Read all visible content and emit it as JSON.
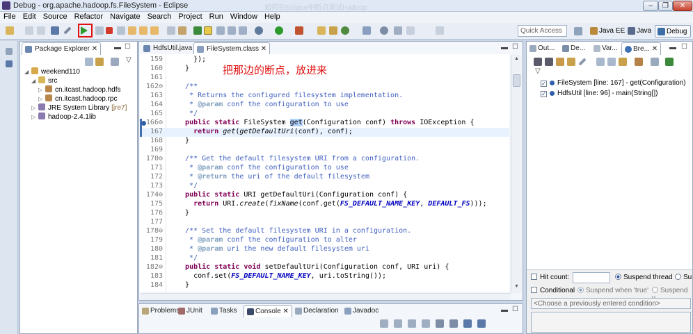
{
  "window": {
    "title": "Debug - org.apache.hadoop.fs.FileSystem - Eclipse",
    "blurred_title": "如何在Eclipse中断点调试Hadoop"
  },
  "menu": [
    "File",
    "Edit",
    "Source",
    "Refactor",
    "Navigate",
    "Search",
    "Project",
    "Run",
    "Window",
    "Help"
  ],
  "toolbar": {
    "quick_access_placeholder": "Quick Access"
  },
  "perspectives": [
    {
      "label": "Java EE"
    },
    {
      "label": "Java"
    },
    {
      "label": "Debug"
    }
  ],
  "package_explorer": {
    "tab": "Package Explorer",
    "tree": [
      {
        "label": "weekend110",
        "depth": 0,
        "expanded": true
      },
      {
        "label": "src",
        "depth": 1,
        "expanded": true
      },
      {
        "label": "cn.itcast.hadoop.hdfs",
        "depth": 2
      },
      {
        "label": "cn.itcast.hadoop.rpc",
        "depth": 2
      },
      {
        "label": "JRE System Library",
        "suffix": "[jre7]",
        "depth": 1
      },
      {
        "label": "hadoop-2.4.1lib",
        "depth": 1
      }
    ]
  },
  "editor": {
    "tabs": [
      {
        "label": "HdfsUtil.java"
      },
      {
        "label": "FileSystem.class"
      }
    ],
    "annotation": "把那边的断点，放进来",
    "lines": [
      {
        "n": "159",
        "h": "    });"
      },
      {
        "n": "160",
        "h": "  }"
      },
      {
        "n": "161",
        "h": ""
      },
      {
        "n": "162⊖",
        "h": "  <span class='cm'>/**</span>"
      },
      {
        "n": "163",
        "h": "<span class='cm'>   * Returns the configured filesystem implementation.</span>"
      },
      {
        "n": "164",
        "h": "<span class='cm'>   * </span><span class='tag'>@param</span><span class='cm'> conf the configuration to use</span>"
      },
      {
        "n": "165",
        "h": "<span class='cm'>   */</span>"
      },
      {
        "n": "166⊖",
        "h": "  <span class='kw'>public static</span> FileSystem <span class='hl-sel'>get</span>(Configuration conf) <span class='kw'>throws</span> IOException {"
      },
      {
        "n": "167",
        "h": "    <span class='kw'>return</span> <span class='it'>get</span>(<span class='it'>getDefaultUri</span>(conf), conf);"
      },
      {
        "n": "168",
        "h": "  }"
      },
      {
        "n": "169",
        "h": ""
      },
      {
        "n": "170⊖",
        "h": "  <span class='cm'>/** Get the default filesystem URI from a configuration.</span>"
      },
      {
        "n": "171",
        "h": "<span class='cm'>   * </span><span class='tag'>@param</span><span class='cm'> conf the configuration to use</span>"
      },
      {
        "n": "172",
        "h": "<span class='cm'>   * </span><span class='tag'>@return</span><span class='cm'> the uri of the default filesystem</span>"
      },
      {
        "n": "173",
        "h": "<span class='cm'>   */</span>"
      },
      {
        "n": "174⊖",
        "h": "  <span class='kw'>public static</span> URI getDefaultUri(Configuration conf) {"
      },
      {
        "n": "175",
        "h": "    <span class='kw'>return</span> URI.<span class='it'>create</span>(<span class='it'>fixName</span>(conf.get(<span class='cst'>FS_DEFAULT_NAME_KEY</span>, <span class='cst'>DEFAULT_FS</span>)));"
      },
      {
        "n": "176",
        "h": "  }"
      },
      {
        "n": "177",
        "h": ""
      },
      {
        "n": "178⊖",
        "h": "  <span class='cm'>/** Set the default filesystem URI in a configuration.</span>"
      },
      {
        "n": "179",
        "h": "<span class='cm'>   * </span><span class='tag'>@param</span><span class='cm'> conf the configuration to alter</span>"
      },
      {
        "n": "180",
        "h": "<span class='cm'>   * </span><span class='tag'>@param</span><span class='cm'> uri the new default filesystem uri</span>"
      },
      {
        "n": "181",
        "h": "<span class='cm'>   */</span>"
      },
      {
        "n": "182⊖",
        "h": "  <span class='kw'>public static void</span> setDefaultUri(Configuration conf, URI uri) {"
      },
      {
        "n": "183",
        "h": "    conf.set(<span class='cst'>FS_DEFAULT_NAME_KEY</span>, uri.toString());"
      },
      {
        "n": "184",
        "h": "  }"
      }
    ]
  },
  "right_views": {
    "tabs": [
      {
        "label": "Out..."
      },
      {
        "label": "De..."
      },
      {
        "label": "Var..."
      },
      {
        "label": "Bre..."
      }
    ],
    "breakpoints": [
      {
        "label": "FileSystem [line: 167] - get(Configuration)",
        "checked": true
      },
      {
        "label": "HdfsUtil [line: 96] - main(String[])",
        "checked": true
      }
    ],
    "hit_count_label": "Hit count:",
    "suspend_thread_label": "Suspend thread",
    "suspend_vm_label": "Su",
    "conditional_label": "Conditional",
    "suspend_true_label": "Suspend when 'true'",
    "suspend_value_label": "Suspend v",
    "condition_placeholder": "<Choose a previously entered condition>"
  },
  "bottom_tabs": [
    {
      "label": "Problems"
    },
    {
      "label": "JUnit"
    },
    {
      "label": "Tasks"
    },
    {
      "label": "Console"
    },
    {
      "label": "Declaration"
    },
    {
      "label": "Javadoc"
    }
  ],
  "colors": {
    "accent_red": "#e01010",
    "selection": "#b3d3ff",
    "keyword": "#7f0055",
    "comment": "#3f5fbf"
  }
}
